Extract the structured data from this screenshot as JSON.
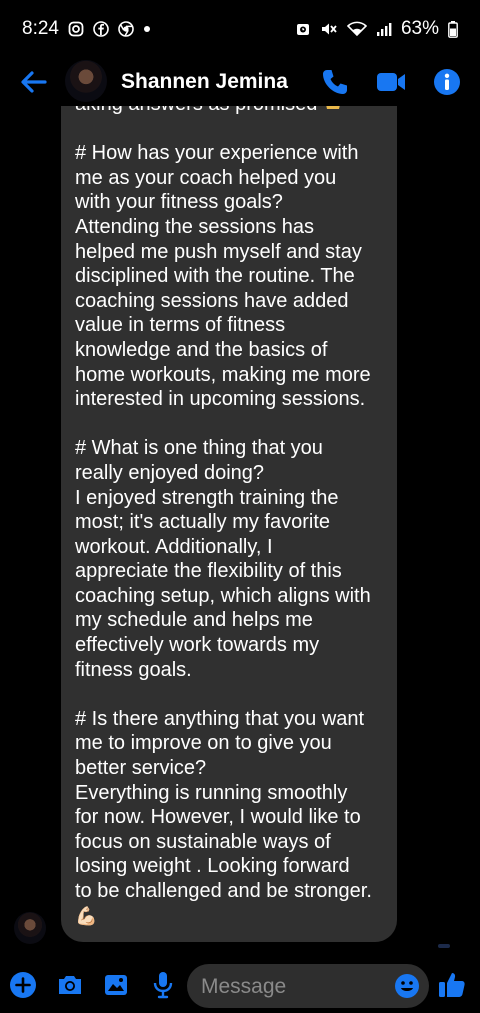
{
  "status_bar": {
    "time": "8:24",
    "battery": "63%",
    "icons_left": [
      "instagram-icon",
      "facebook-icon",
      "chrome-icon",
      "dot"
    ],
    "icons_right": [
      "alarm-icon",
      "mute-icon",
      "wifi-icon",
      "signal-icon",
      "battery-icon"
    ]
  },
  "header": {
    "contact_name": "Shannen Jemina",
    "accent_color": "#1877f2",
    "actions": [
      "phone-icon",
      "video-icon",
      "info-icon"
    ]
  },
  "message": {
    "cut_off_line": "aking answers as promised",
    "text": "# How has your experience with\nme as your coach helped you\nwith your fitness goals?\nAttending the sessions has\nhelped me push myself and stay\ndisciplined with the routine. The\ncoaching sessions have added\nvalue in terms of fitness\nknowledge and the basics of\nhome workouts, making me more\ninterested in upcoming sessions.\n\n# What is one thing that you\nreally enjoyed doing?\nI enjoyed strength training the\nmost; it's actually my favorite\nworkout. Additionally, I\nappreciate the flexibility of this\ncoaching setup, which aligns with\nmy schedule and helps me\neffectively work towards my\nfitness goals.\n\n# Is there anything that you want\nme to improve on to give you\nbetter service?\nEverything is running smoothly\nfor now. However, I would like to\nfocus on sustainable ways of\nlosing weight . Looking forward\nto be challenged and be stronger.",
    "end_emoji": "💪🏻",
    "bubble_color": "#303030"
  },
  "composer": {
    "placeholder": "Message",
    "buttons": [
      "plus-icon",
      "camera-icon",
      "gallery-icon",
      "microphone-icon",
      "emoji-icon",
      "like-icon"
    ]
  }
}
